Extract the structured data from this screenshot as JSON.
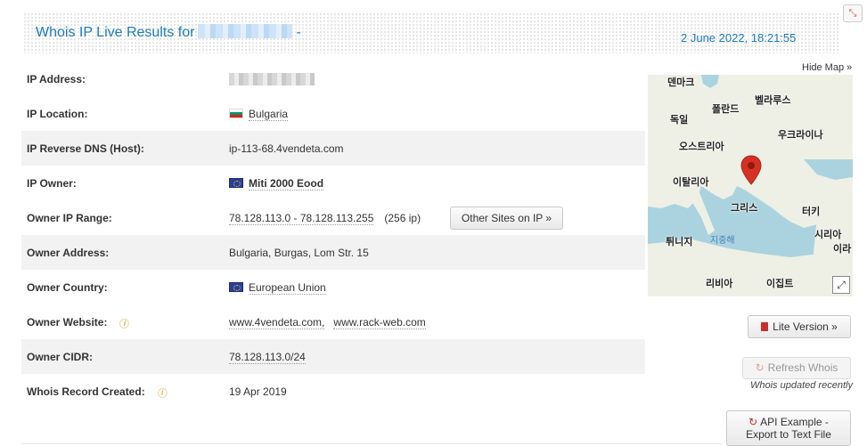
{
  "header": {
    "title": "Whois IP Live Results for",
    "dash": "-",
    "date": "2 June 2022, 18:21:55",
    "expand_icon": "collapse-arrows-icon",
    "expand_glyph": "⤡"
  },
  "rows": [
    {
      "label": "IP Address:"
    },
    {
      "label": "IP Location:",
      "value": "Bulgaria"
    },
    {
      "label": "IP Reverse DNS (Host):",
      "value": "ip-113-68.4vendeta.com"
    },
    {
      "label": "IP Owner:",
      "value": "Miti 2000 Eood"
    },
    {
      "label": "Owner IP Range:",
      "value": "78.128.113.0 - 78.128.113.255",
      "count": "(256 ip)"
    },
    {
      "label": "Owner Address:",
      "value": "Bulgaria, Burgas, Lom Str. 15"
    },
    {
      "label": "Owner Country:",
      "value": "European Union"
    },
    {
      "label": "Owner Website:",
      "value": "www.4vendeta.com,",
      "value2": "www.rack-web.com"
    },
    {
      "label": "Owner CIDR:",
      "value": "78.128.113.0/24"
    },
    {
      "label": "Whois Record Created:",
      "value": "19 Apr 2019"
    }
  ],
  "info_glyph": "i",
  "buttons": {
    "other_sites": "Other Sites on IP »",
    "lite_version": "Lite Version »",
    "refresh": "Refresh Whois",
    "refresh_glyph": "↻",
    "api_line1": "API Example -",
    "api_line2": "Export to Text File",
    "api_glyph": "↻"
  },
  "whois_updated": "Whois updated recently",
  "map": {
    "hide_label": "Hide Map »",
    "fullscreen_glyph": "⤢",
    "labels": [
      {
        "text": "덴마크",
        "sea": false
      },
      {
        "text": "벨라루스",
        "sea": false
      },
      {
        "text": "폴란드",
        "sea": false
      },
      {
        "text": "독일",
        "sea": false
      },
      {
        "text": "우크라이나",
        "sea": false
      },
      {
        "text": "오스트리아",
        "sea": false
      },
      {
        "text": "이탈리아",
        "sea": false
      },
      {
        "text": "그리스",
        "sea": false
      },
      {
        "text": "터키",
        "sea": false
      },
      {
        "text": "튀니지",
        "sea": false
      },
      {
        "text": "지중해",
        "sea": true
      },
      {
        "text": "시리아",
        "sea": false
      },
      {
        "text": "이라",
        "sea": false
      },
      {
        "text": "리비아",
        "sea": false
      },
      {
        "text": "이집트",
        "sea": false
      }
    ],
    "colors": {
      "sea": "#aad3df",
      "land": "#eef0e6",
      "pin": "#d93025"
    }
  }
}
